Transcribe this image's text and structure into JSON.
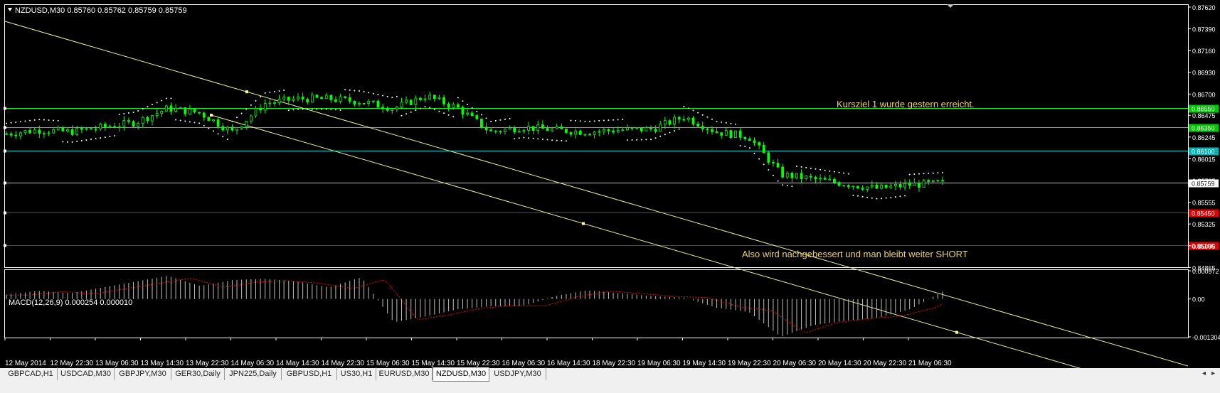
{
  "symbol_info": "NZDUSD,M30  0.85760 0.85762 0.85759 0.85759",
  "macd_info": "MACD(12,26,9) 0.000254 0.000010",
  "annotations": {
    "target": "Kursziel 1 wurde gestern erreicht.",
    "short": "Also wird nachgebessert und man bleibt weiter SHORT"
  },
  "price_scale": [
    {
      "label": "0.87620",
      "value": 0.8762
    },
    {
      "label": "0.87390",
      "value": 0.8739
    },
    {
      "label": "0.87160",
      "value": 0.8716
    },
    {
      "label": "0.86930",
      "value": 0.8693
    },
    {
      "label": "0.86700",
      "value": 0.867
    },
    {
      "label": "0.86475",
      "value": 0.86475
    },
    {
      "label": "0.86245",
      "value": 0.86245
    },
    {
      "label": "0.86015",
      "value": 0.86015
    },
    {
      "label": "0.85785",
      "value": 0.85785
    },
    {
      "label": "0.85555",
      "value": 0.85555
    },
    {
      "label": "0.85325",
      "value": 0.85325
    },
    {
      "label": "0.85095",
      "value": 0.85095
    },
    {
      "label": "0.84865",
      "value": 0.84865
    }
  ],
  "horizontal_levels": [
    {
      "label": "0.86550",
      "value": 0.8655,
      "color": "#00ff00",
      "label_bg": "#00c800"
    },
    {
      "label": "0.86350",
      "value": 0.8635,
      "color": "#00ff00",
      "label_bg": "#00c800"
    },
    {
      "label": "0.86100",
      "value": 0.861,
      "color": "#00c8c8",
      "label_bg": "#00b4b4"
    },
    {
      "label": "0.85759",
      "value": 0.85759,
      "color": "#c0c0c0",
      "label_bg": "#ffffff"
    },
    {
      "label": "0.85450",
      "value": 0.8545,
      "color": "#ff0000",
      "label_bg": "#e00000"
    },
    {
      "label": "0.85100",
      "value": 0.851,
      "color": "#ff0000",
      "label_bg": "#e00000"
    }
  ],
  "macd_scale": [
    {
      "label": "0.000972",
      "value": 0.000972
    },
    {
      "label": "0.00",
      "value": 0.0
    },
    {
      "label": "-0.001304",
      "value": -0.001304
    }
  ],
  "time_labels": [
    "12 May 2014",
    "12 May 22:30",
    "13 May 06:30",
    "13 May 14:30",
    "13 May 22:30",
    "14 May 06:30",
    "14 May 14:30",
    "14 May 22:30",
    "15 May 06:30",
    "15 May 14:30",
    "15 May 22:30",
    "16 May 06:30",
    "16 May 14:30",
    "18 May 22:30",
    "19 May 06:30",
    "19 May 14:30",
    "19 May 22:30",
    "20 May 06:30",
    "20 May 14:30",
    "20 May 22:30",
    "21 May 06:30"
  ],
  "tabs": [
    "GBPCAD,H1",
    "USDCAD,M30",
    "GBPJPY,M30",
    "GER30,Daily",
    "JPN225,Daily",
    "GBPUSD,H1",
    "US30,H1",
    "EURUSD,M30",
    "NZDUSD,M30",
    "USDJPY,M30"
  ],
  "active_tab": 8,
  "nav": {
    "left": "◂",
    "right": "▸"
  },
  "colors": {
    "background": "#000000",
    "grid": "#ffffff",
    "candle": "#00ff00",
    "channel": "#f0f08c",
    "sar": "#ffffff",
    "annotation": "#f0d264",
    "macd_hist": "#c0c0c0",
    "macd_signal": "#ff0000"
  },
  "chart_data": {
    "type": "candlestick",
    "symbol": "NZDUSD",
    "timeframe": "M30",
    "ylim": [
      0.8486,
      0.8765
    ],
    "close_series": [
      0.8628,
      0.8632,
      0.863,
      0.8635,
      0.864,
      0.8655,
      0.865,
      0.863,
      0.866,
      0.8665,
      0.8665,
      0.8662,
      0.8655,
      0.8668,
      0.8655,
      0.863,
      0.8635,
      0.8632,
      0.863,
      0.8632,
      0.8633,
      0.8646,
      0.863,
      0.8625,
      0.8585,
      0.858,
      0.8575,
      0.857,
      0.8574,
      0.85759
    ],
    "macd_histogram": [
      0.00015,
      0.00028,
      0.0002,
      0.0004,
      0.0006,
      0.0008,
      0.00045,
      0.00065,
      0.0007,
      0.0006,
      0.0004,
      0.00075,
      -0.0008,
      -0.0006,
      -0.00035,
      -0.00025,
      -0.00025,
      0.0001,
      0.0003,
      0.0002,
      0.0001,
      5e-05,
      -0.0003,
      -0.00045,
      -0.0013,
      -0.0009,
      -0.00075,
      -0.00065,
      -0.00035,
      0.00025
    ]
  }
}
